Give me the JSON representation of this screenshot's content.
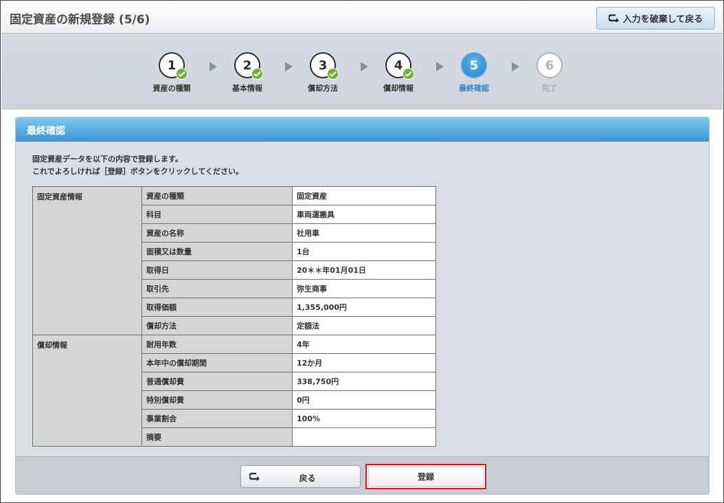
{
  "header": {
    "title": "固定資産の新規登録 (5/6)",
    "discard_label": "入力を破棄して戻る"
  },
  "steps": [
    {
      "num": "1",
      "label": "資産の種類",
      "state": "done"
    },
    {
      "num": "2",
      "label": "基本情報",
      "state": "done"
    },
    {
      "num": "3",
      "label": "償却方法",
      "state": "done"
    },
    {
      "num": "4",
      "label": "償却情報",
      "state": "done"
    },
    {
      "num": "5",
      "label": "最終確認",
      "state": "current"
    },
    {
      "num": "6",
      "label": "完了",
      "state": "future"
    }
  ],
  "panel": {
    "title": "最終確認",
    "intro_line1": "固定資産データを以下の内容で登録します。",
    "intro_line2": "これでよろしければ［登録］ボタンをクリックしてください。"
  },
  "table": {
    "groups": [
      {
        "name": "固定資産情報",
        "rows": [
          {
            "item": "資産の種類",
            "value": "固定資産"
          },
          {
            "item": "科目",
            "value": "車両運搬具"
          },
          {
            "item": "資産の名称",
            "value": "社用車"
          },
          {
            "item": "面積又は数量",
            "value": "1台"
          },
          {
            "item": "取得日",
            "value": "20＊＊年01月01日"
          },
          {
            "item": "取引先",
            "value": "弥生商事"
          },
          {
            "item": "取得価額",
            "value": "1,355,000円"
          },
          {
            "item": "償却方法",
            "value": "定額法"
          }
        ]
      },
      {
        "name": "償却情報",
        "rows": [
          {
            "item": "耐用年数",
            "value": "4年"
          },
          {
            "item": "本年中の償却期間",
            "value": "12か月"
          },
          {
            "item": "普通償却費",
            "value": "338,750円"
          },
          {
            "item": "特別償却費",
            "value": "0円"
          },
          {
            "item": "事業割合",
            "value": "100%"
          },
          {
            "item": "摘要",
            "value": ""
          }
        ]
      }
    ]
  },
  "footer": {
    "back_label": "戻る",
    "register_label": "登録"
  },
  "colors": {
    "accent": "#3f97d6",
    "done_check": "#6fb12e",
    "highlight_border": "#e1121a"
  },
  "icons": {
    "discard": "return-arrow-icon",
    "back": "return-arrow-icon",
    "done": "checkmark-icon",
    "step_separator": "triangle-right-icon"
  }
}
